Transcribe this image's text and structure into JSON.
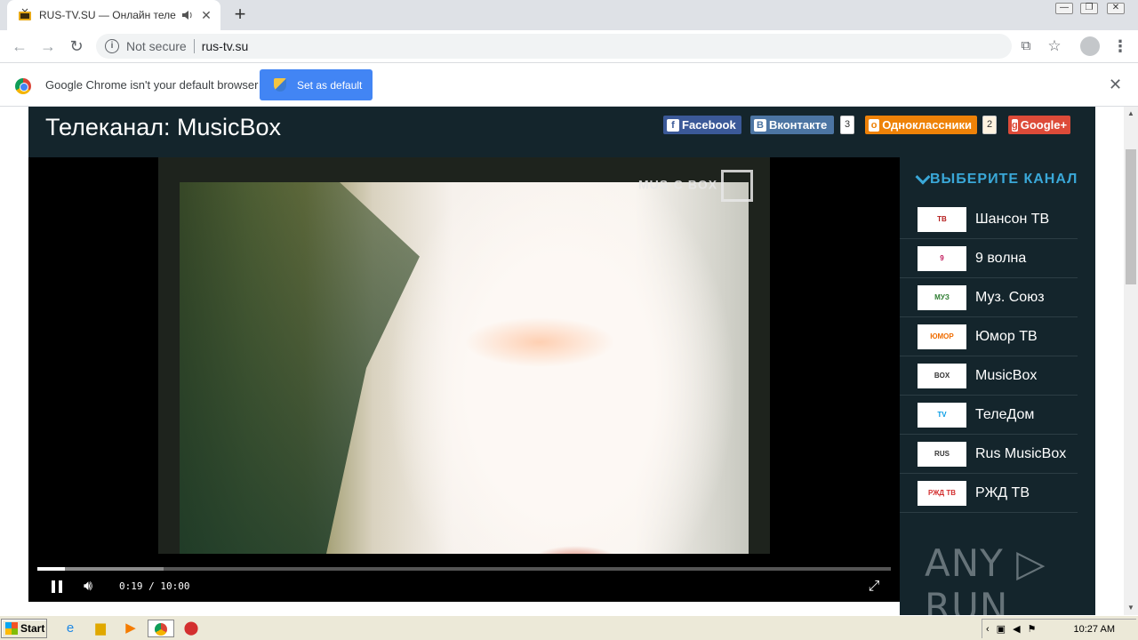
{
  "browser": {
    "tab_title": "RUS-TV.SU — Онлайн телевид",
    "new_tab_symbol": "+",
    "window_controls": {
      "minimize": "—",
      "maximize": "❐",
      "close": "✕"
    },
    "security_label": "Not secure",
    "url": "rus-tv.su"
  },
  "infobar": {
    "message": "Google Chrome isn't your default browser",
    "button_label": "Set as default",
    "close_symbol": "✕"
  },
  "page": {
    "title": "Телеканал: MusicBox",
    "share": {
      "facebook": "Facebook",
      "vkontakte": "Вконтакте",
      "vkontakte_count": "3",
      "odnoklassniki": "Одноклассники",
      "odnoklassniki_count": "2",
      "googleplus": "Google+"
    },
    "player": {
      "time": "0:19 / 10:00",
      "played_fraction": 0.032,
      "buffered_fraction": 0.148,
      "channel_logo": "MUS·C BOX"
    },
    "sidebar": {
      "heading": "ВЫБЕРИТЕ КАНАЛ",
      "channels": [
        {
          "name": "Шансон ТВ",
          "thumb": "TB",
          "thumb_color": "#b51c1c"
        },
        {
          "name": "9 волна",
          "thumb": "9",
          "thumb_color": "#c2185b"
        },
        {
          "name": "Муз. Союз",
          "thumb": "МУЗ",
          "thumb_color": "#2e7d32"
        },
        {
          "name": "Юмор ТВ",
          "thumb": "ЮМОР",
          "thumb_color": "#ef6c00"
        },
        {
          "name": "MusicBox",
          "thumb": "BOX",
          "thumb_color": "#333333"
        },
        {
          "name": "ТелеДом",
          "thumb": "TV",
          "thumb_color": "#039be5"
        },
        {
          "name": "Rus MusicBox",
          "thumb": "RUS",
          "thumb_color": "#333333"
        },
        {
          "name": "РЖД ТВ",
          "thumb": "РЖД ТВ",
          "thumb_color": "#d32f2f"
        }
      ],
      "watermark": "ANY ▷ RUN"
    }
  },
  "taskbar": {
    "start_label": "Start",
    "clock": "10:27 AM"
  },
  "colors": {
    "header_bg": "#14252c",
    "accent": "#3aa8d8",
    "chrome_blue": "#4285f4"
  }
}
